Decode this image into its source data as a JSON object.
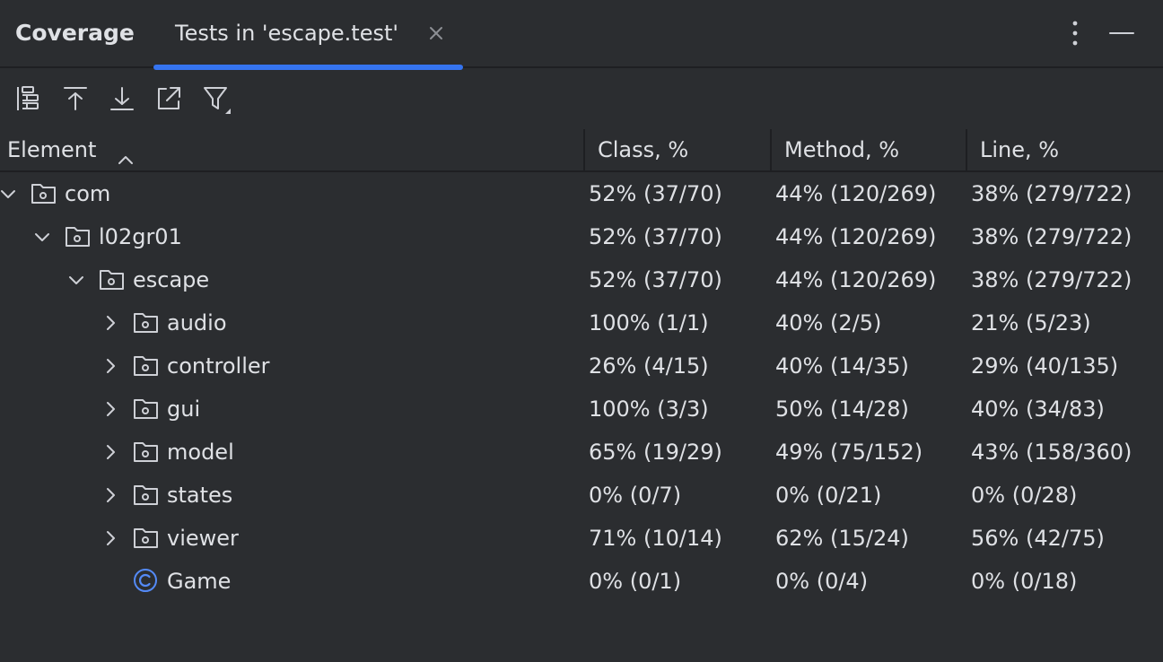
{
  "header": {
    "tool_title": "Coverage",
    "tab_label": "Tests in 'escape.test'",
    "accent": "#3574f0"
  },
  "toolbar": {
    "icons": [
      "flatten-packages-icon",
      "navigate-up-icon",
      "navigate-down-icon",
      "export-icon",
      "filter-icon"
    ]
  },
  "columns": {
    "element": "Element",
    "class": "Class, %",
    "method": "Method, %",
    "line": "Line, %"
  },
  "rows": [
    {
      "name": "com",
      "depth": 0,
      "kind": "package",
      "expanded": true,
      "class": "52% (37/70)",
      "method": "44% (120/269)",
      "line": "38% (279/722)"
    },
    {
      "name": "l02gr01",
      "depth": 1,
      "kind": "package",
      "expanded": true,
      "class": "52% (37/70)",
      "method": "44% (120/269)",
      "line": "38% (279/722)"
    },
    {
      "name": "escape",
      "depth": 2,
      "kind": "package",
      "expanded": true,
      "class": "52% (37/70)",
      "method": "44% (120/269)",
      "line": "38% (279/722)"
    },
    {
      "name": "audio",
      "depth": 3,
      "kind": "package",
      "expanded": false,
      "class": "100% (1/1)",
      "method": "40% (2/5)",
      "line": "21% (5/23)"
    },
    {
      "name": "controller",
      "depth": 3,
      "kind": "package",
      "expanded": false,
      "class": "26% (4/15)",
      "method": "40% (14/35)",
      "line": "29% (40/135)"
    },
    {
      "name": "gui",
      "depth": 3,
      "kind": "package",
      "expanded": false,
      "class": "100% (3/3)",
      "method": "50% (14/28)",
      "line": "40% (34/83)"
    },
    {
      "name": "model",
      "depth": 3,
      "kind": "package",
      "expanded": false,
      "class": "65% (19/29)",
      "method": "49% (75/152)",
      "line": "43% (158/360)"
    },
    {
      "name": "states",
      "depth": 3,
      "kind": "package",
      "expanded": false,
      "class": "0% (0/7)",
      "method": "0% (0/21)",
      "line": "0% (0/28)"
    },
    {
      "name": "viewer",
      "depth": 3,
      "kind": "package",
      "expanded": false,
      "class": "71% (10/14)",
      "method": "62% (15/24)",
      "line": "56% (42/75)"
    },
    {
      "name": "Game",
      "depth": 3,
      "kind": "class",
      "expanded": null,
      "class": "0% (0/1)",
      "method": "0% (0/4)",
      "line": "0% (0/18)"
    }
  ]
}
